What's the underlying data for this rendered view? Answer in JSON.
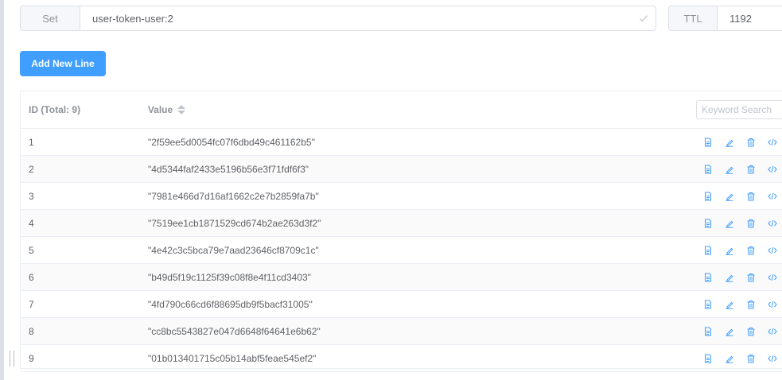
{
  "key": {
    "type_label": "Set",
    "name": "user-token-user:2",
    "icon": "check-icon"
  },
  "ttl": {
    "label": "TTL",
    "value": "1192"
  },
  "toolbar": {
    "add_line_label": "Add New Line"
  },
  "table": {
    "headers": {
      "id": "ID (Total: 9)",
      "value": "Value"
    },
    "search_placeholder": "Keyword Search",
    "row_actions": [
      "document-icon",
      "edit-icon",
      "delete-icon",
      "code-icon"
    ],
    "rows": [
      {
        "id": "1",
        "value": "\"2f59ee5d0054fc07f6dbd49c461162b5\""
      },
      {
        "id": "2",
        "value": "\"4d5344faf2433e5196b56e3f71fdf6f3\""
      },
      {
        "id": "3",
        "value": "\"7981e466d7d16af1662c2e7b2859fa7b\""
      },
      {
        "id": "4",
        "value": "\"7519ee1cb1871529cd674b2ae263d3f2\""
      },
      {
        "id": "5",
        "value": "\"4e42c3c5bca79e7aad23646cf8709c1c\""
      },
      {
        "id": "6",
        "value": "\"b49d5f19c1125f39c08f8e4f11cd3403\""
      },
      {
        "id": "7",
        "value": "\"4fd790c66cd6f88695db9f5bacf31005\""
      },
      {
        "id": "8",
        "value": "\"cc8bc5543827e047d6648f64641e6b62\""
      },
      {
        "id": "9",
        "value": "\"01b013401715c05b14abf5feae545ef2\""
      }
    ]
  },
  "colors": {
    "primary": "#409eff",
    "border": "#dcdfe6",
    "text": "#606266",
    "muted": "#909399"
  }
}
